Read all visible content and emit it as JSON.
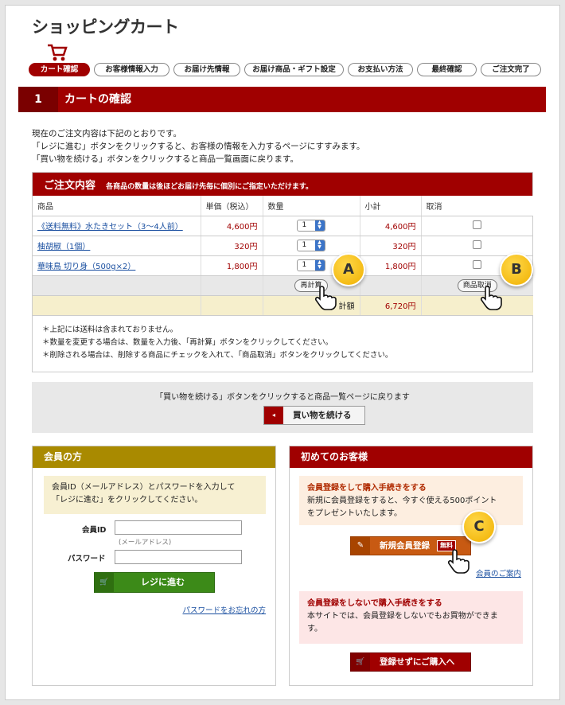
{
  "page": {
    "title": "ショッピングカート"
  },
  "steps": [
    "カート確認",
    "お客様情報入力",
    "お届け先情報",
    "お届け商品・ギフト設定",
    "お支払い方法",
    "最終確認",
    "ご注文完了"
  ],
  "section": {
    "num": "1",
    "label": "カートの確認"
  },
  "intro": [
    "現在のご注文内容は下記のとおりです。",
    "「レジに進む」ボタンをクリックすると、お客様の情報を入力するページにすすみます。",
    "「買い物を続ける」ボタンをクリックすると商品一覧画面に戻ります。"
  ],
  "order": {
    "title": "ご注文内容",
    "subtitle": "各商品の数量は後ほどお届け先毎に個別にご指定いただけます。",
    "headers": [
      "商品",
      "単価（税込）",
      "数量",
      "小計",
      "取消"
    ],
    "rows": [
      {
        "name": "《送料無料》水たきセット（3〜4人前）",
        "price": "4,600円",
        "qty": "1",
        "subtotal": "4,600円"
      },
      {
        "name": "柚胡椒（1個）",
        "price": "320円",
        "qty": "1",
        "subtotal": "320円"
      },
      {
        "name": "華味鳥 切り身（500g×2）",
        "price": "1,800円",
        "qty": "1",
        "subtotal": "1,800円"
      }
    ],
    "recalc_label": "再計算",
    "delete_label": "商品取消",
    "total_label": "計額",
    "total_value": "6,720円",
    "notes": [
      "＊上記には送料は含まれておりません。",
      "＊数量を変更する場合は、数量を入力後、「再計算」ボタンをクリックしてください。",
      "＊削除される場合は、削除する商品にチェックを入れて、「商品取消」ボタンをクリックしてください。"
    ]
  },
  "continue": {
    "message": "「買い物を続ける」ボタンをクリックすると商品一覧ページに戻ります",
    "button": "買い物を続ける"
  },
  "member": {
    "title": "会員の方",
    "note": [
      "会員ID（メールアドレス）とパスワードを入力して",
      "「レジに進む」をクリックしてください。"
    ],
    "id_label": "会員ID",
    "id_hint": "(メールアドレス)",
    "pw_label": "パスワード",
    "login_button": "レジに進む",
    "forgot_link": "パスワードをお忘れの方"
  },
  "newcust": {
    "title": "初めてのお客様",
    "reg_heading": "会員登録をして購入手続きをする",
    "reg_text": [
      "新規に会員登録をすると、今すぐ使える500ポイント",
      "をプレゼントいたします。"
    ],
    "reg_button": "新規会員登録",
    "free_badge": "無料",
    "guide_link": "会員のご案内",
    "guest_heading": "会員登録をしないで購入手続きをする",
    "guest_text": [
      "本サイトでは、会員登録をしないでもお買物ができま",
      "す。"
    ],
    "guest_button": "登録せずにご購入へ"
  },
  "callouts": [
    "A",
    "B",
    "C"
  ]
}
